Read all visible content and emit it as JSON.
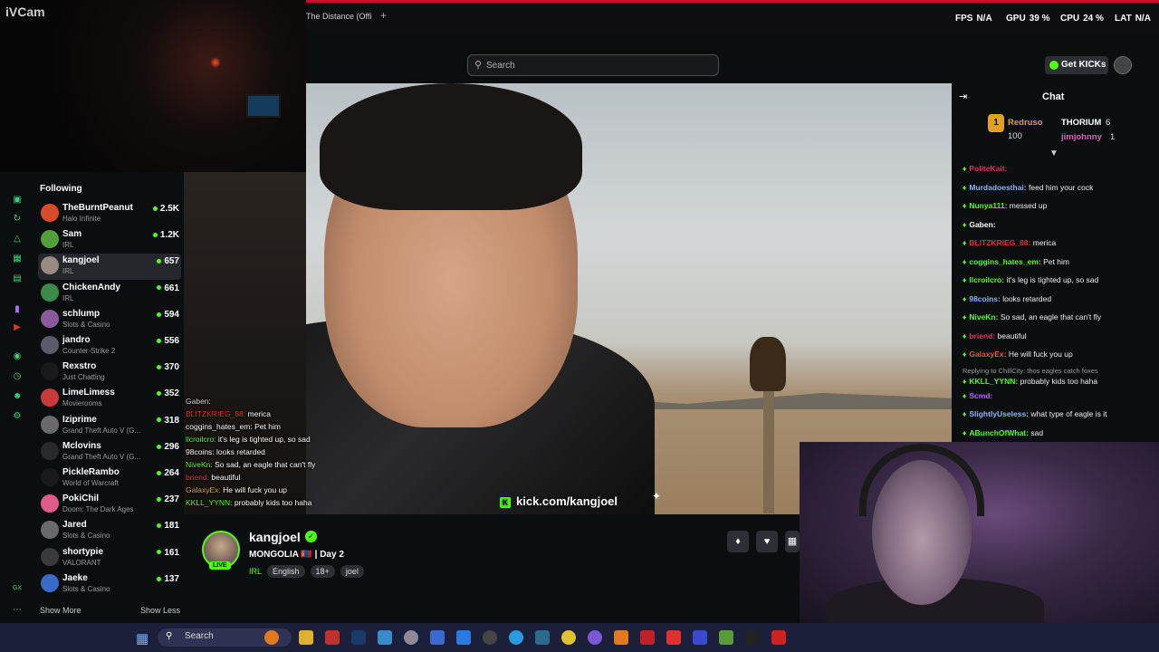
{
  "ivcam": {
    "label": "iVCam"
  },
  "tabbar": {
    "tab_title": "The Distance (Offi",
    "new_tab": "+"
  },
  "hud": {
    "fps_label": "FPS",
    "fps_value": "N/A",
    "gpu_label": "GPU",
    "gpu_value": "39 %",
    "cpu_label": "CPU",
    "cpu_value": "24 %",
    "lat_label": "LAT",
    "lat_value": "N/A"
  },
  "extensions": [
    "bookmark-icon",
    "tab-icon",
    "shield-icon",
    "play-icon",
    "heart-icon",
    "puzzle-icon",
    "extension-icon",
    "download-icon",
    "AI",
    "menu-icon"
  ],
  "extensions_ai": "AI",
  "header": {
    "search_placeholder": "Search",
    "get_kicks": "Get KICKs"
  },
  "sidebar": {
    "heading": "Following",
    "items": [
      {
        "name": "TheBurntPeanut",
        "category": "Halo Infinite",
        "viewers": "2.5K",
        "color": "#d94a2a"
      },
      {
        "name": "Sam",
        "category": "IRL",
        "viewers": "1.2K",
        "color": "#53a03a"
      },
      {
        "name": "kangjoel",
        "category": "IRL",
        "viewers": "657",
        "color": "#9a8a80"
      },
      {
        "name": "ChickenAndy",
        "category": "IRL",
        "viewers": "661",
        "color": "#3a8a4a"
      },
      {
        "name": "schlump",
        "category": "Slots & Casino",
        "viewers": "594",
        "color": "#8a5a9a"
      },
      {
        "name": "jandro",
        "category": "Counter-Strike 2",
        "viewers": "556",
        "color": "#5a5a6a"
      },
      {
        "name": "Rexstro",
        "category": "Just Chatting",
        "viewers": "370",
        "color": "#1a1a1a"
      },
      {
        "name": "LimeLimess",
        "category": "Movierooms",
        "viewers": "352",
        "color": "#c83a3a"
      },
      {
        "name": "Iziprime",
        "category": "Grand Theft Auto V (G...",
        "viewers": "318",
        "color": "#6a6a6a"
      },
      {
        "name": "Mclovins",
        "category": "Grand Theft Auto V (G...",
        "viewers": "296",
        "color": "#2a2a2a"
      },
      {
        "name": "PickleRambo",
        "category": "World of Warcraft",
        "viewers": "264",
        "color": "#1a1a1a"
      },
      {
        "name": "PokiChil",
        "category": "Doom: The Dark Ages",
        "viewers": "237",
        "color": "#e05a8a"
      },
      {
        "name": "Jared",
        "category": "Slots & Casino",
        "viewers": "181",
        "color": "#6a6a6a"
      },
      {
        "name": "shortypie",
        "category": "VALORANT",
        "viewers": "161",
        "color": "#3a3a3a"
      },
      {
        "name": "Jaeke",
        "category": "Slots & Casino",
        "viewers": "137",
        "color": "#3a6ac8"
      }
    ],
    "show_more": "Show More",
    "show_less": "Show Less"
  },
  "overlay_chat": [
    {
      "user": "Gaben:",
      "text": "",
      "color": "#cfcfcf"
    },
    {
      "user": "BLITZKRIEG_88:",
      "text": "merica",
      "color": "#e03030"
    },
    {
      "user": "coggins_hates_em:",
      "text": "Pet him",
      "color": "#ffffff"
    },
    {
      "user": "llcroilcro:",
      "text": "it's leg is tighted up, so sad",
      "color": "#53fc18"
    },
    {
      "user": "98coins:",
      "text": "looks retarded",
      "color": "#ffffff"
    },
    {
      "user": "NiveKn:",
      "text": "So sad, an eagle that can't fly",
      "color": "#53fc18"
    },
    {
      "user": "briend:",
      "text": "beautiful",
      "color": "#e03060"
    },
    {
      "user": "GalaxyEx:",
      "text": "He will fuck you up",
      "color": "#e0a030"
    },
    {
      "user": "KKLL_YYNN:",
      "text": "probably kids too haha",
      "color": "#53fc18"
    }
  ],
  "video": {
    "link": "kick.com/kangjoel"
  },
  "stream": {
    "channel": "kangjoel",
    "live_label": "LIVE",
    "title": "MONGOLIA 🇲🇳 | Day 2",
    "category": "IRL",
    "tags": [
      "English",
      "18+",
      "joel"
    ]
  },
  "chat": {
    "title": "Chat",
    "gifters": [
      {
        "name": "Redruso",
        "amount": "100",
        "rank": "1"
      },
      {
        "name": "THORIUM",
        "amount": "6"
      },
      {
        "name": "jimjohnny",
        "amount": "1"
      }
    ],
    "messages": [
      {
        "user": "PoliteKait:",
        "text": "",
        "color": "#e03060"
      },
      {
        "user": "Murdadoesthai:",
        "text": "feed him your cock",
        "color": "#8ab4ff"
      },
      {
        "user": "Nunya111:",
        "text": "messed up",
        "color": "#53fc18"
      },
      {
        "user": "Gaben:",
        "text": "",
        "color": "#ffffff"
      },
      {
        "user": "BLITZKRIEG_88:",
        "text": "merica",
        "color": "#e03030"
      },
      {
        "user": "coggins_hates_em:",
        "text": "Pet him",
        "color": "#53fc18"
      },
      {
        "user": "llcroilcro:",
        "text": "it's leg is tighted up, so sad",
        "color": "#53fc18"
      },
      {
        "user": "98coins:",
        "text": "looks retarded",
        "color": "#8ab4ff"
      },
      {
        "user": "NiveKn:",
        "text": "So sad, an eagle that can't fly",
        "color": "#53fc18"
      },
      {
        "user": "briend:",
        "text": "beautiful",
        "color": "#e03060"
      },
      {
        "user": "GalaxyEx:",
        "text": "He will fuck you up",
        "color": "#e05a30"
      },
      {
        "user": "KKLL_YYNN:",
        "text": "probably kids too haha",
        "color": "#53fc18",
        "reply": "Replying to ChillCity: thos eagles catch foxes"
      },
      {
        "user": "Scmd:",
        "text": "",
        "color": "#c060ff"
      },
      {
        "user": "SlightlyUseless:",
        "text": "what type of eagle is it",
        "color": "#8ab4ff"
      },
      {
        "user": "ABunchOfWhat:",
        "text": "sad",
        "color": "#53fc18"
      }
    ]
  },
  "taskbar": {
    "search": "Search"
  },
  "colors": {
    "accent": "#53fc18",
    "bg": "#0b0e0f",
    "panel": "#2c2f33"
  }
}
